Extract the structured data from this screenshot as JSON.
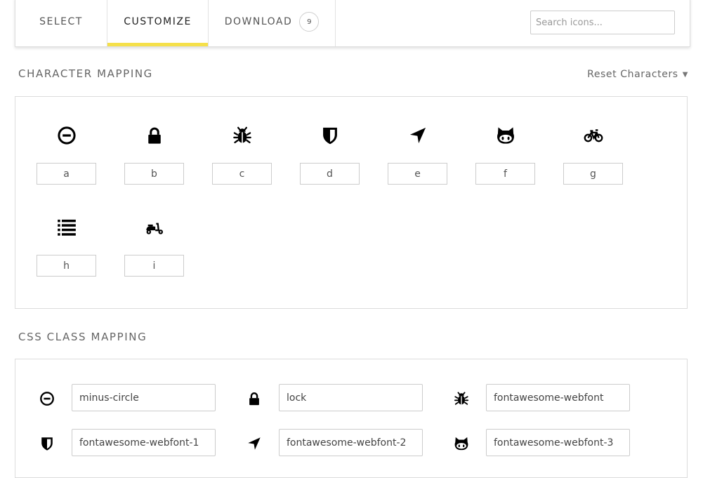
{
  "tabs": {
    "select": "SELECT",
    "customize": "CUSTOMIZE",
    "download": "DOWNLOAD",
    "download_count": "9"
  },
  "search": {
    "placeholder": "Search icons..."
  },
  "character_mapping": {
    "title": "CHARACTER MAPPING",
    "reset_label": "Reset Characters",
    "glyphs": [
      {
        "icon": "minus-circle-icon",
        "char": "a"
      },
      {
        "icon": "lock-icon",
        "char": "b"
      },
      {
        "icon": "bug-icon",
        "char": "c"
      },
      {
        "icon": "shield-icon",
        "char": "d"
      },
      {
        "icon": "location-arrow-icon",
        "char": "e"
      },
      {
        "icon": "github-cat-icon",
        "char": "f"
      },
      {
        "icon": "bicycle-icon",
        "char": "g"
      },
      {
        "icon": "list-icon",
        "char": "h"
      },
      {
        "icon": "scooter-icon",
        "char": "i"
      }
    ]
  },
  "css_class_mapping": {
    "title": "CSS CLASS MAPPING",
    "rows": [
      {
        "icon": "minus-circle-icon",
        "class_name": "minus-circle"
      },
      {
        "icon": "lock-icon",
        "class_name": "lock"
      },
      {
        "icon": "bug-icon",
        "class_name": "fontawesome-webfont"
      },
      {
        "icon": "shield-icon",
        "class_name": "fontawesome-webfont-1"
      },
      {
        "icon": "location-arrow-icon",
        "class_name": "fontawesome-webfont-2"
      },
      {
        "icon": "github-cat-icon",
        "class_name": "fontawesome-webfont-3"
      }
    ]
  },
  "colors": {
    "accent": "#f5e04a"
  }
}
